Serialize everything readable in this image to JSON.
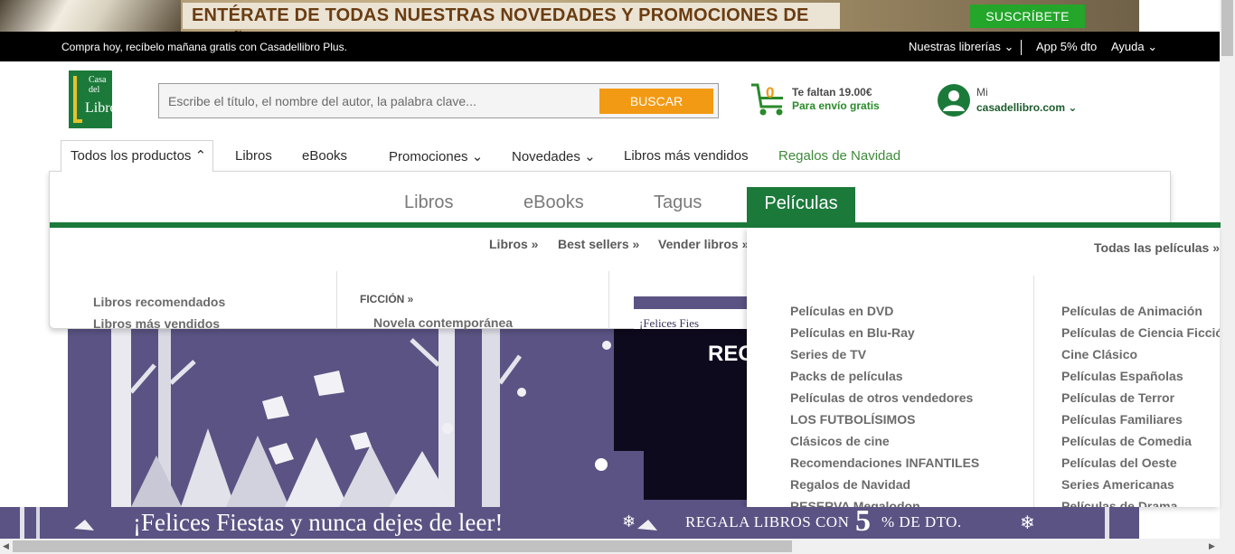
{
  "promo": {
    "text": "ENTÉRATE DE TODAS NUESTRAS NOVEDADES Y PROMOCIONES DE OTOÑO",
    "subscribe": "SUSCRÍBETE"
  },
  "topbar": {
    "message": "Compra hoy, recíbelo mañana gratis con Casadellibro Plus.",
    "librerias": "Nuestras librerías",
    "app": "App 5% dto",
    "ayuda": "Ayuda"
  },
  "logo": {
    "line1": "Casa",
    "line2": "del",
    "line3": "Libro"
  },
  "search": {
    "placeholder": "Escribe el título, el nombre del autor, la palabra clave...",
    "button": "BUSCAR"
  },
  "cart": {
    "count": "0",
    "line1": "Te faltan 19.00€",
    "line2": "Para envío gratis"
  },
  "account": {
    "mi": "Mi",
    "site": "casadellibro.com"
  },
  "nav": {
    "todos": "Todos los productos",
    "libros": "Libros",
    "ebooks": "eBooks",
    "promociones": "Promociones",
    "novedades": "Novedades",
    "mas_vendidos": "Libros más vendidos",
    "regalos": "Regalos de Navidad"
  },
  "mega": {
    "tabs": [
      "Libros",
      "eBooks",
      "Tagus",
      "Películas"
    ],
    "sublinks": [
      "Libros »",
      "Best sellers »",
      "Vender libros »"
    ],
    "col1": [
      "Libros recomendados",
      "Libros más vendidos"
    ],
    "ficcion": "FICCIÓN »",
    "col2": [
      "Novela contemporánea"
    ],
    "mini_banner": "¡Felices Fies"
  },
  "hero": {
    "text": "REG"
  },
  "peliculas": {
    "todas": "Todas las películas »",
    "left": [
      "Películas en DVD",
      "Películas en Blu-Ray",
      "Series de TV",
      "Packs de películas",
      "Películas de otros vendedores",
      "LOS FUTBOLÍSIMOS",
      "Clásicos de cine",
      "Recomendaciones INFANTILES",
      "Regalos de Navidad",
      "RESERVA Megalodon"
    ],
    "right": [
      "Películas de Animación",
      "Películas de Ciencia Ficción",
      "Cine Clásico",
      "Películas Españolas",
      "Películas de Terror",
      "Películas Familiares",
      "Películas de Comedia",
      "Películas del Oeste",
      "Series Americanas",
      "Películas de Drama"
    ]
  },
  "bottom_banner": {
    "main": "¡Felices Fiestas y nunca dejes de leer!",
    "regala": "REGALA LIBROS CON",
    "five": "5",
    "dto": "% DE DTO."
  },
  "colors": {
    "brand_green": "#1b7a3a",
    "accent_orange": "#f39a14",
    "banner_purple": "#5a5383"
  }
}
